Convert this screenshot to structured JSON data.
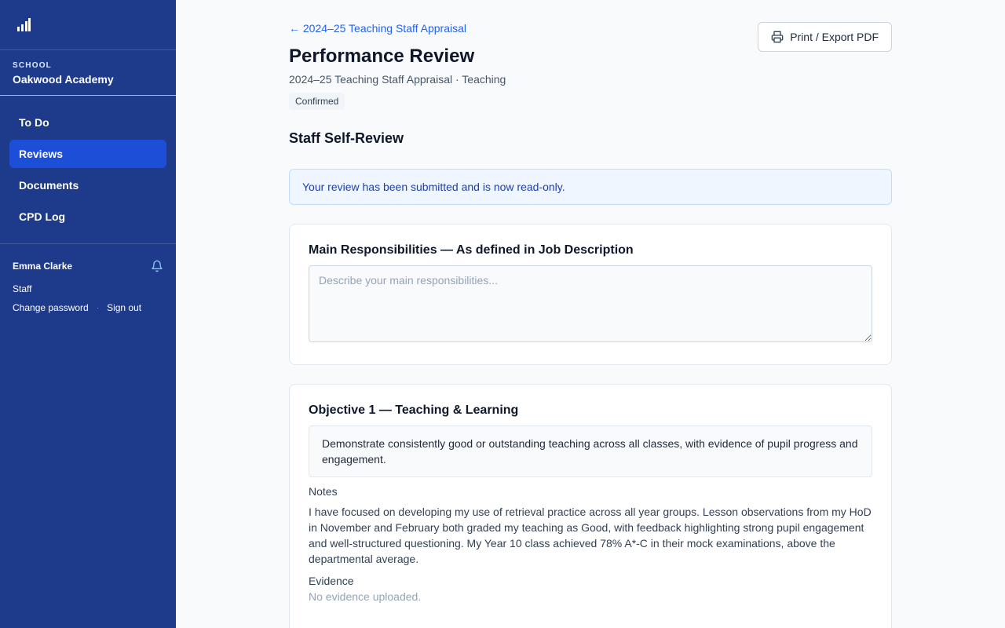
{
  "sidebar": {
    "school_label": "SCHOOL",
    "school_name": "Oakwood Academy",
    "nav": [
      {
        "label": "To Do",
        "active": false
      },
      {
        "label": "Reviews",
        "active": true
      },
      {
        "label": "Documents",
        "active": false
      },
      {
        "label": "CPD Log",
        "active": false
      }
    ],
    "user": {
      "name": "Emma Clarke",
      "role": "Staff",
      "change_password": "Change password",
      "separator": "·",
      "sign_out": "Sign out"
    }
  },
  "header": {
    "back_link": "← 2024–25 Teaching Staff Appraisal",
    "title": "Performance Review",
    "subtitle": "2024–25 Teaching Staff Appraisal · Teaching",
    "status_badge": "Confirmed",
    "print_button": "Print / Export PDF"
  },
  "section": {
    "title": "Staff Self-Review",
    "info_banner": "Your review has been submitted and is now read-only."
  },
  "responsibilities": {
    "title": "Main Responsibilities — As defined in Job Description",
    "placeholder": "Describe your main responsibilities..."
  },
  "objective1": {
    "title": "Objective 1 — Teaching & Learning",
    "description": "Demonstrate consistently good or outstanding teaching across all classes, with evidence of pupil progress and engagement.",
    "notes_label": "Notes",
    "notes": "I have focused on developing my use of retrieval practice across all year groups. Lesson observations from my HoD in November and February both graded my teaching as Good, with feedback highlighting strong pupil engagement and well-structured questioning. My Year 10 class achieved 78% A*-C in their mock examinations, above the departmental average.",
    "evidence_label": "Evidence",
    "evidence_empty": "No evidence uploaded."
  },
  "colors": {
    "sidebar_bg": "#1e3a8a",
    "nav_active": "#1d4ed8",
    "link": "#2563eb",
    "banner_bg": "#eff6ff"
  },
  "icons": [
    "bar-chart-logo-icon",
    "bell-icon",
    "printer-icon"
  ]
}
